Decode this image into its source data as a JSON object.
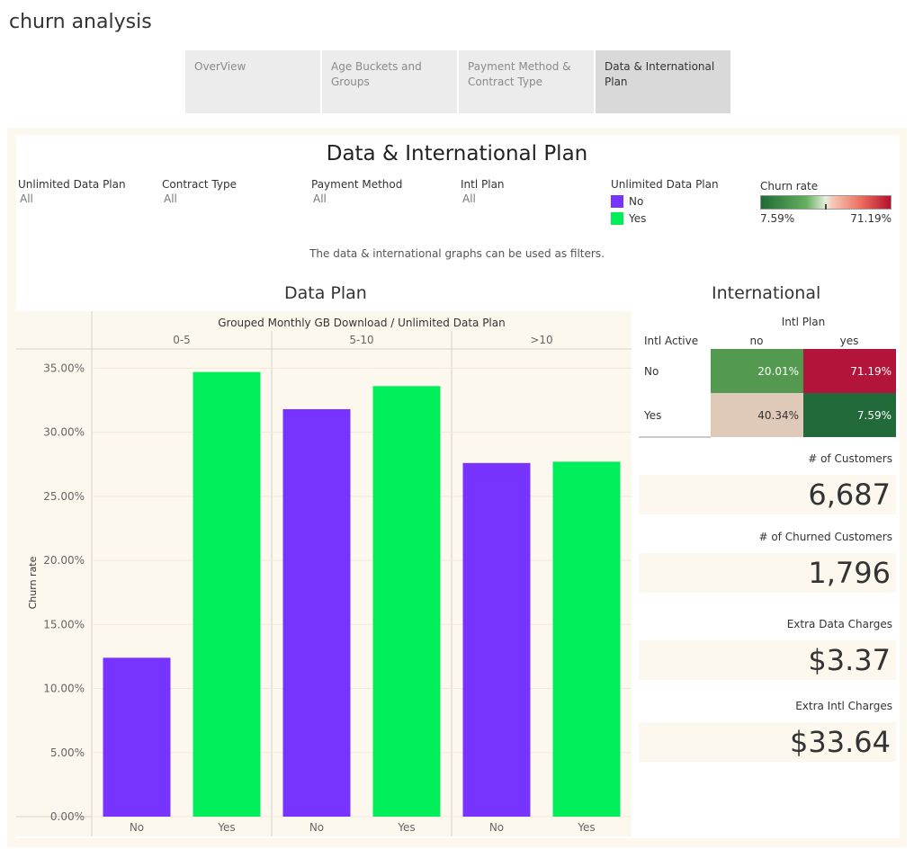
{
  "app": {
    "title": "churn analysis"
  },
  "tabs": [
    {
      "label": "OverView",
      "active": false
    },
    {
      "label": "Age Buckets and Groups",
      "active": false
    },
    {
      "label": "Payment Method & Contract Type",
      "active": false
    },
    {
      "label": "Data & International Plan",
      "active": true
    }
  ],
  "dashboard": {
    "title": "Data & International Plan",
    "caption": "The data & international graphs can be used as filters."
  },
  "filters": [
    {
      "label": "Unlimited Data Plan",
      "value": "All"
    },
    {
      "label": "Contract Type",
      "value": "All"
    },
    {
      "label": "Payment Method",
      "value": "All"
    },
    {
      "label": "Intl Plan",
      "value": "All"
    }
  ],
  "color_legend": {
    "title": "Unlimited Data Plan",
    "items": [
      {
        "label": "No",
        "color": "#7733ff"
      },
      {
        "label": "Yes",
        "color": "#00ee5a"
      }
    ]
  },
  "churn_legend": {
    "title": "Churn rate",
    "min": "7.59%",
    "max": "71.19%"
  },
  "data_plan": {
    "title": "Data Plan"
  },
  "international": {
    "title": "International"
  },
  "chart_data": {
    "type": "bar",
    "header": "Grouped Monthly GB Download  /  Unlimited Data Plan",
    "ylabel": "Churn rate",
    "ylim": [
      0,
      36.5
    ],
    "yticks": [
      "0.00%",
      "5.00%",
      "10.00%",
      "15.00%",
      "20.00%",
      "25.00%",
      "30.00%",
      "35.00%"
    ],
    "groups": [
      "0-5",
      "5-10",
      ">10"
    ],
    "categories": [
      "No",
      "Yes"
    ],
    "series": [
      {
        "name": "No",
        "color": "#7733ff",
        "values": [
          12.4,
          31.8,
          27.6
        ]
      },
      {
        "name": "Yes",
        "color": "#00ee5a",
        "values": [
          34.7,
          33.6,
          27.7
        ]
      }
    ]
  },
  "heatmap": {
    "title": "Intl Plan",
    "row_header": "Intl Active",
    "columns": [
      "no",
      "yes"
    ],
    "rows": [
      {
        "label": "No",
        "cells": [
          {
            "text": "20.01%",
            "color": "#539a50"
          },
          {
            "text": "71.19%",
            "color": "#b3143a"
          }
        ]
      },
      {
        "label": "Yes",
        "cells": [
          {
            "text": "40.34%",
            "color": "#dfc9b8"
          },
          {
            "text": "7.59%",
            "color": "#236a3a"
          }
        ]
      }
    ]
  },
  "kpis": [
    {
      "label": "# of Customers",
      "value": "6,687"
    },
    {
      "label": "# of Churned Customers",
      "value": "1,796"
    },
    {
      "label": "Extra Data Charges",
      "value": "$3.37"
    },
    {
      "label": "Extra Intl Charges",
      "value": "$33.64"
    }
  ]
}
